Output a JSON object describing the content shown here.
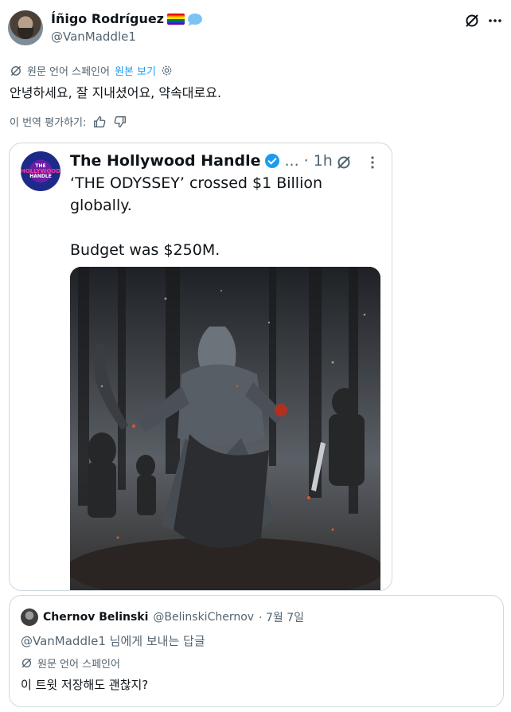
{
  "tweet": {
    "author_name": "Íñigo Rodríguez",
    "author_handle": "@VanMaddle1",
    "translated_from": "원문 언어 스페인어",
    "view_original": "원본 보기",
    "text": "안녕하세요, 잘 지내셨어요, 약속대로요.",
    "rate_translation": "이 번역 평가하기:"
  },
  "quoted_post": {
    "name": "The Hollywood Handle",
    "ellipsis": "...",
    "time": "· 1h",
    "line1": "‘THE ODYSSEY’ crossed $1 Billion globally.",
    "line2": "Budget was $250M.",
    "logo_text": [
      "THE",
      "HOLLYWOOD",
      "HANDLE"
    ]
  },
  "quote_reply": {
    "name": "Chernov Belinski",
    "handle": "@BelinskiChernov",
    "date": "· 7월 7일",
    "reply_to": "@VanMaddle1 님에게 보내는 답글",
    "translated_from": "원문 언어 스페인어",
    "text": "이 트윗 저장해도 괜찮지?"
  },
  "colors": {
    "accent": "#1d9bf0",
    "muted": "#536471",
    "border": "#cfd9de"
  },
  "icons": [
    "grok-icon",
    "more-icon",
    "translate-icon",
    "settings-icon",
    "thumbs-up-icon",
    "thumbs-down-icon",
    "verified-icon"
  ]
}
